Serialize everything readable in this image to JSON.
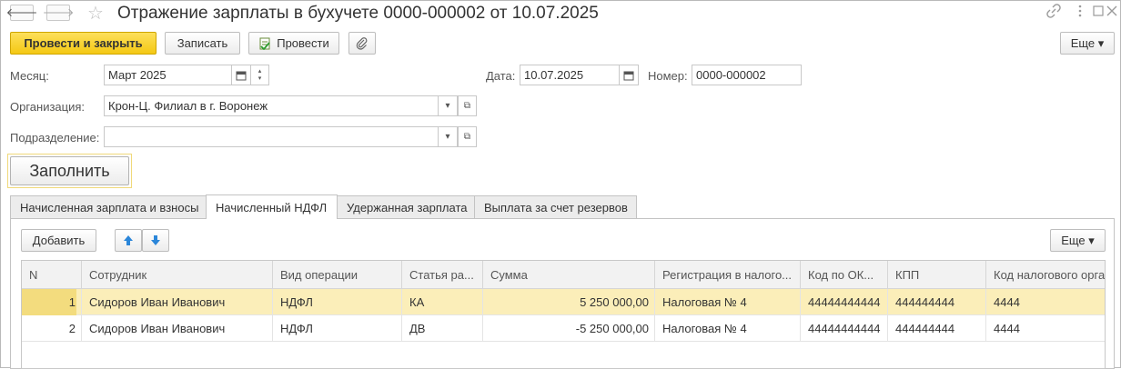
{
  "window": {
    "title": "Отражение зарплаты в бухучете 0000-000002 от 10.07.2025",
    "icons": {
      "back": "arrow-left-icon",
      "forward": "arrow-right-icon",
      "favorite": "star-icon",
      "link": "link-icon",
      "menu": "vertical-dots-icon",
      "maximize": "maximize-icon",
      "close": "close-icon"
    }
  },
  "toolbar": {
    "post_close_label": "Провести и закрыть",
    "save_label": "Записать",
    "post_label": "Провести",
    "more_label": "Еще ▾"
  },
  "form": {
    "month_label": "Месяц:",
    "month_value": "Март 2025",
    "date_label": "Дата:",
    "date_value": "10.07.2025",
    "number_label": "Номер:",
    "number_value": "0000-000002",
    "org_label": "Организация:",
    "org_value": "Крон-Ц. Филиал в г. Воронеж",
    "dept_label": "Подразделение:",
    "dept_value": "",
    "fill_label": "Заполнить"
  },
  "tabs": [
    {
      "label": "Начисленная зарплата и взносы",
      "active": false
    },
    {
      "label": "Начисленный НДФЛ",
      "active": true
    },
    {
      "label": "Удержанная зарплата",
      "active": false
    },
    {
      "label": "Выплата за счет резервов",
      "active": false
    }
  ],
  "table_toolbar": {
    "add_label": "Добавить",
    "more_label": "Еще ▾"
  },
  "table": {
    "columns": [
      "N",
      "Сотрудник",
      "Вид операции",
      "Статья ра...",
      "Сумма",
      "Регистрация в налого...",
      "Код по ОК...",
      "КПП",
      "Код налогового орга"
    ],
    "rows": [
      {
        "n": "1",
        "employee": "Сидоров Иван Иванович",
        "operation": "НДФЛ",
        "article": "КА",
        "amount": "5 250 000,00",
        "registration": "Налоговая № 4",
        "okato": "44444444444",
        "kpp": "444444444",
        "tax_code": "4444",
        "selected": true
      },
      {
        "n": "2",
        "employee": "Сидоров Иван Иванович",
        "operation": "НДФЛ",
        "article": "ДВ",
        "amount": "-5 250 000,00",
        "registration": "Налоговая № 4",
        "okato": "44444444444",
        "kpp": "444444444",
        "tax_code": "4444",
        "selected": false
      }
    ]
  }
}
